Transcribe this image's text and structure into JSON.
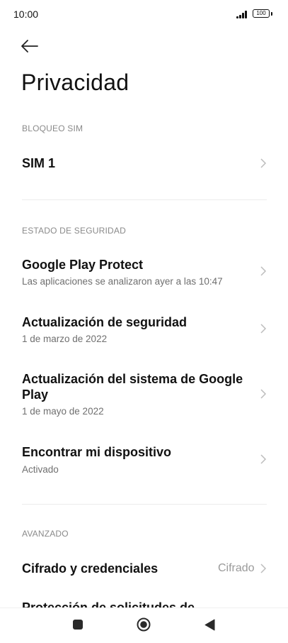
{
  "status_bar": {
    "time": "10:00",
    "battery": "100"
  },
  "page": {
    "title": "Privacidad"
  },
  "sections": {
    "sim_lock": {
      "header": "BLOQUEO SIM",
      "items": [
        {
          "title": "SIM 1"
        }
      ]
    },
    "security_state": {
      "header": "ESTADO DE SEGURIDAD",
      "items": [
        {
          "title": "Google Play Protect",
          "subtitle": "Las aplicaciones se analizaron ayer a las 10:47"
        },
        {
          "title": "Actualización de seguridad",
          "subtitle": "1 de marzo de 2022"
        },
        {
          "title": "Actualización del sistema de Google Play",
          "subtitle": "1 de mayo de 2022"
        },
        {
          "title": "Encontrar mi dispositivo",
          "subtitle": "Activado"
        }
      ]
    },
    "advanced": {
      "header": "AVANZADO",
      "items": [
        {
          "title": "Cifrado y credenciales",
          "value": "Cifrado"
        },
        {
          "title": "Protección de solicitudes de"
        }
      ]
    }
  },
  "icons": {
    "back": "arrow-left-icon",
    "chevron": "chevron-right-icon",
    "nav_recents": "square-icon",
    "nav_home": "circle-icon",
    "nav_back": "triangle-back-icon"
  },
  "colors": {
    "section_header": "#8a8a8a",
    "subtitle": "#6f6f6f",
    "chevron": "#bdbdbd"
  }
}
